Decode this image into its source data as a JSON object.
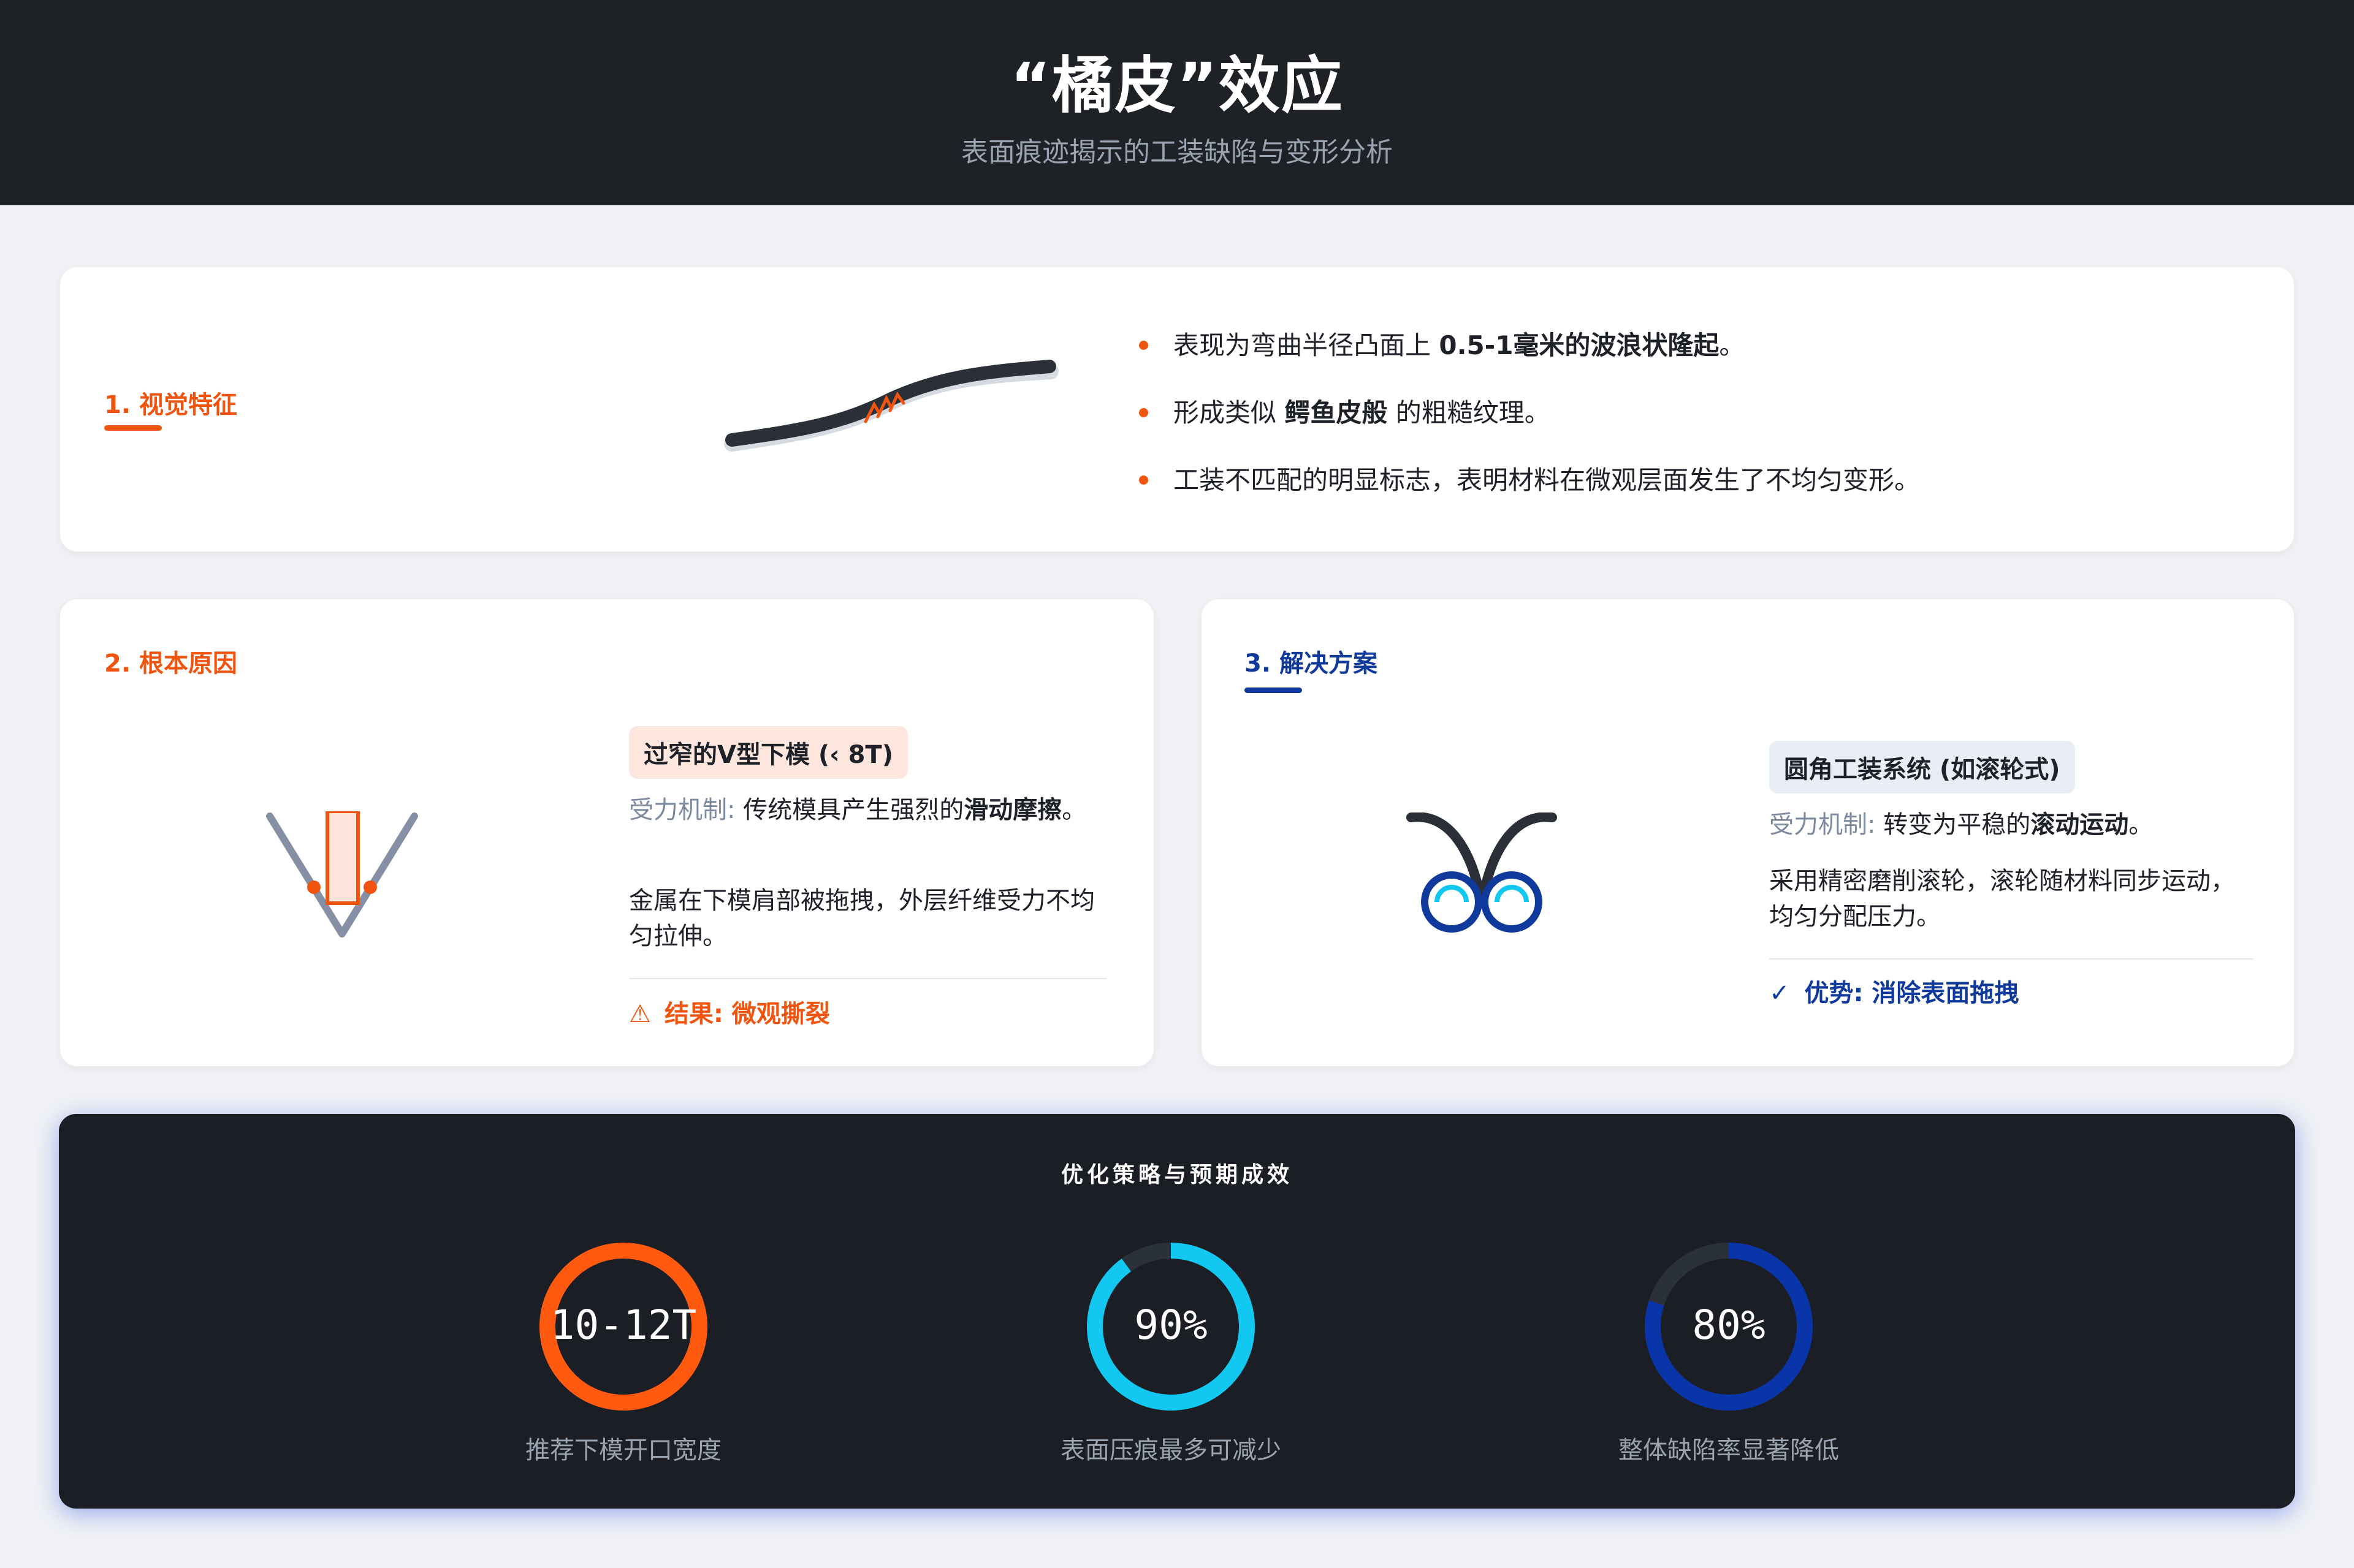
{
  "header": {
    "title": "“橘皮”效应",
    "subtitle": "表面痕迹揭示的工装缺陷与变形分析"
  },
  "section1": {
    "title": "1. 视觉特征",
    "bullets": [
      {
        "pre": "表现为弯曲半径凸面上 ",
        "bold": "0.5-1毫米的波浪状隆起",
        "post": "。"
      },
      {
        "pre": "形成类似 ",
        "bold": "鳄鱼皮般",
        "post": " 的粗糙纹理。"
      },
      {
        "pre": "工装不匹配的明显标志，表明材料在微观层面发生了不均匀变形。",
        "bold": "",
        "post": ""
      }
    ]
  },
  "section2": {
    "title": "2. 根本原因",
    "tag": "过窄的V型下模 (‹ 8T)",
    "mech_label": "受力机制:",
    "mech_pre": " 传统模具产生强烈的",
    "mech_bold": "滑动摩擦",
    "mech_post": "。",
    "desc": "金属在下模肩部被拖拽，外层纤维受力不均匀拉伸。",
    "result": "结果: 微观撕裂",
    "warning_icon": "warning-icon"
  },
  "section3": {
    "title": "3. 解决方案",
    "tag": "圆角工装系统 (如滚轮式)",
    "mech_label": "受力机制:",
    "mech_pre": " 转变为平稳的",
    "mech_bold": "滚动运动",
    "mech_post": "。",
    "desc": "采用精密磨削滚轮，滚轮随材料同步运动，均匀分配压力。",
    "advantage": "优势: 消除表面拖拽",
    "check_icon": "check-icon"
  },
  "results": {
    "title": "优化策略与预期成效",
    "metrics": [
      {
        "value": "10-12T",
        "caption": "推荐下模开口宽度",
        "progress": 1.0,
        "color": "#ff5a10"
      },
      {
        "value": "90%",
        "caption": "表面压痕最多可减少",
        "progress": 0.9,
        "color": "#12c8f0"
      },
      {
        "value": "80%",
        "caption": "整体缺陷率显著降低",
        "progress": 0.8,
        "color": "#0a35a8"
      }
    ]
  },
  "colors": {
    "accent_orange": "#f0540f",
    "accent_blue": "#0f3a9c",
    "header_bg": "#1e2126",
    "page_bg": "#f0f2f5"
  }
}
